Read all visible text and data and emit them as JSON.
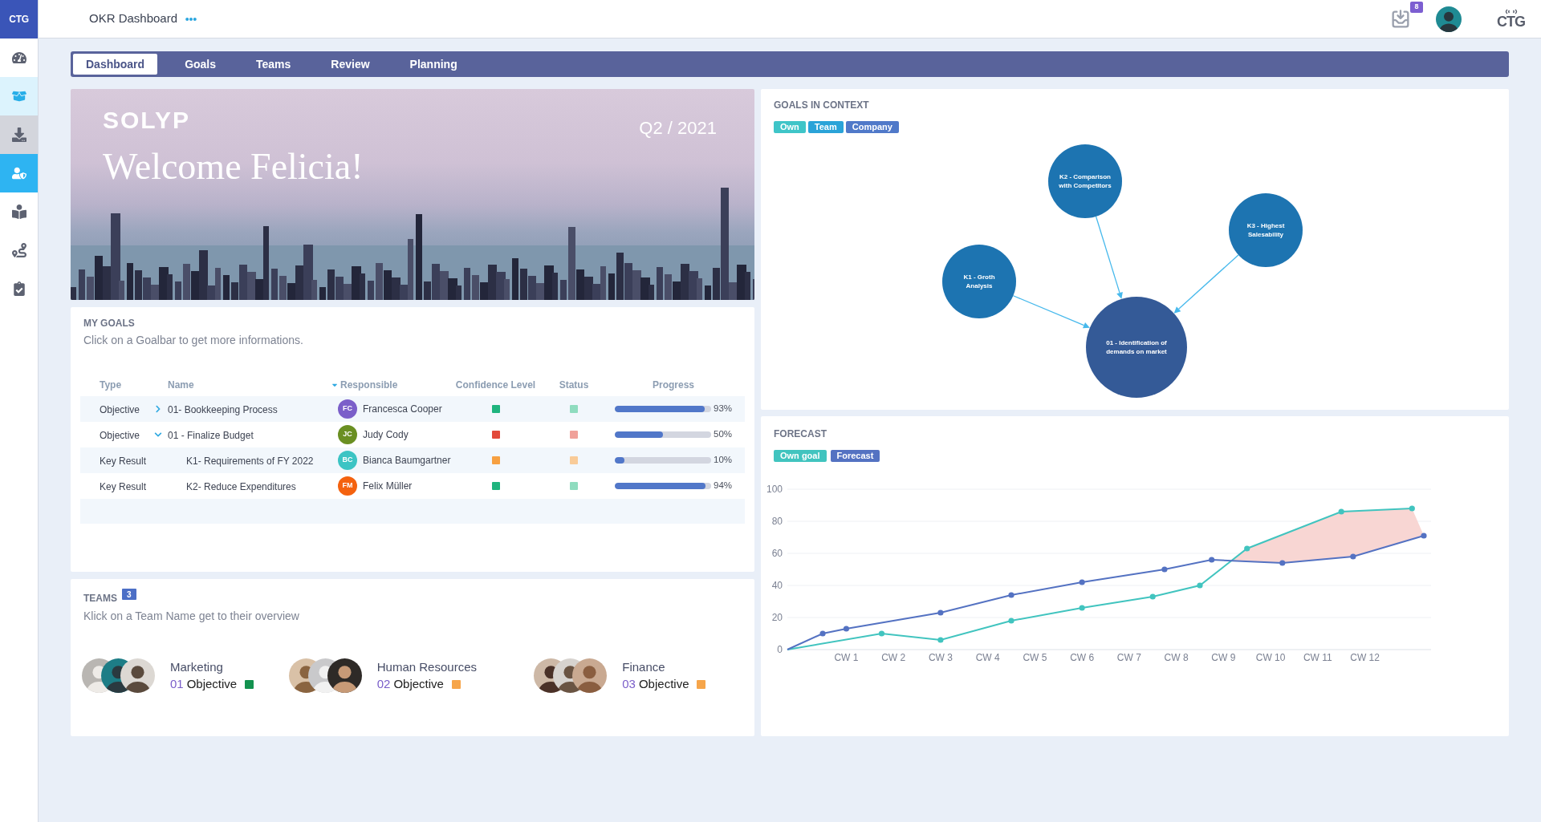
{
  "sidebar": {
    "logo": "CTG",
    "items": [
      {
        "selected": false,
        "hovered": false,
        "pressed": false
      },
      {
        "selected": false,
        "hovered": true,
        "pressed": false
      },
      {
        "selected": false,
        "hovered": false,
        "pressed": true
      },
      {
        "selected": true,
        "hovered": false,
        "pressed": false
      },
      {
        "selected": false,
        "hovered": false,
        "pressed": false
      },
      {
        "selected": false,
        "hovered": false,
        "pressed": false
      },
      {
        "selected": false,
        "hovered": false,
        "pressed": false
      }
    ]
  },
  "header": {
    "title": "OKR Dashboard",
    "notification_count": "8",
    "brand": "CTG"
  },
  "tabs": [
    {
      "label": "Dashboard",
      "selected": true
    },
    {
      "label": "Goals",
      "selected": false
    },
    {
      "label": "Teams",
      "selected": false
    },
    {
      "label": "Review",
      "selected": false
    },
    {
      "label": "Planning",
      "selected": false
    }
  ],
  "hero": {
    "brand": "SOLYP",
    "greeting": "Welcome Felicia!",
    "period": "Q2 / 2021"
  },
  "my_goals": {
    "title": "MY GOALS",
    "subtitle": "Click on a Goalbar to get more informations.",
    "columns": [
      {
        "label": "Type",
        "sorted": false
      },
      {
        "label": "Name",
        "sorted": false
      },
      {
        "label": "Responsible",
        "sorted": true
      },
      {
        "label": "Confidence Level",
        "sorted": false
      },
      {
        "label": "Status",
        "sorted": false
      },
      {
        "label": "Progress",
        "sorted": false
      }
    ],
    "rows": [
      {
        "type": "Objective",
        "name": "01- Bookkeeping Process",
        "expanded": false,
        "responsible": {
          "initials": "FC",
          "name": "Francesca Cooper",
          "color": "#7b5fc9"
        },
        "confidence": {
          "color": "#1fb47e"
        },
        "status": {
          "color": "#8fdcbf"
        },
        "level": 0.93,
        "progress": "93%"
      },
      {
        "type": "Objective",
        "name": "01 - Finalize Budget",
        "expanded": true,
        "responsible": {
          "initials": "JC",
          "name": "Judy Cody",
          "color": "#6a8f22"
        },
        "confidence": {
          "color": "#e2493a"
        },
        "status": {
          "color": "#f0a19a"
        },
        "level": 0.5,
        "progress": "50%",
        "children": [
          {
            "type": "Key Result",
            "name": "K1- Requirements of FY 2022",
            "responsible": {
              "initials": "BC",
              "name": "Bianca Baumgartner",
              "color": "#3cc4c4"
            },
            "confidence": {
              "color": "#f7a041"
            },
            "status": {
              "color": "#f9cb98"
            },
            "level": 0.1,
            "progress": "10%"
          },
          {
            "type": "Key Result",
            "name": "K2- Reduce Expenditures",
            "responsible": {
              "initials": "FM",
              "name": "Felix Müller",
              "color": "#f4620f"
            },
            "confidence": {
              "color": "#1fb47e"
            },
            "status": {
              "color": "#8fdcbf"
            },
            "level": 0.94,
            "progress": "94%"
          }
        ]
      }
    ]
  },
  "teams": {
    "title": "TEAMS",
    "count": "3",
    "subtitle": "Klick on a Team Name get to their overview",
    "items": [
      {
        "name": "Marketing",
        "number": "01",
        "label": "Objective",
        "color": "#13924f"
      },
      {
        "name": "Human Resources",
        "number": "02",
        "label": "Objective",
        "color": "#f6a54a"
      },
      {
        "name": "Finance",
        "number": "03",
        "label": "Objective",
        "color": "#f6a54a"
      }
    ]
  },
  "goals_context": {
    "title": "GOALS IN CONTEXT",
    "filters": [
      {
        "label": "Own",
        "color": "#3fc5c8"
      },
      {
        "label": "Team",
        "color": "#2aa3d8"
      },
      {
        "label": "Company",
        "color": "#5079c9"
      }
    ],
    "goal_map": {
      "label": "01 - Identification of demands on market",
      "children": [
        {
          "label": "K2 - Comparison with Competitors"
        },
        {
          "label": "K3 - Highest Salesability"
        },
        {
          "label": "K1 - Groth Analysis"
        }
      ]
    }
  },
  "forecast": {
    "title": "FORECAST",
    "chart_data": {
      "type": "line",
      "grid": true,
      "categories": [
        null,
        null,
        null,
        null,
        null,
        "CW 1",
        null,
        null,
        null,
        "CW 2",
        null,
        null,
        null,
        "CW 3",
        null,
        null,
        null,
        "CW 4",
        null,
        null,
        null,
        "CW 5",
        null,
        null,
        null,
        "CW 6",
        null,
        null,
        null,
        "CW 7",
        null,
        null,
        null,
        "CW 8",
        null,
        null,
        null,
        "CW 9",
        null,
        null,
        null,
        "CW 10",
        null,
        null,
        null,
        "CW 11",
        null,
        null,
        null,
        "CW 12",
        null,
        null,
        null,
        null,
        null
      ],
      "ylim": [
        0,
        100
      ],
      "yticks": [
        0,
        20,
        40,
        60,
        80,
        100
      ],
      "series": [
        {
          "name": "Own goal",
          "color": "#41c4bf",
          "marker": "circle",
          "values": [
            0,
            null,
            null,
            null,
            null,
            null,
            null,
            null,
            10,
            null,
            null,
            null,
            null,
            6,
            null,
            null,
            null,
            null,
            null,
            18,
            null,
            null,
            null,
            null,
            null,
            26,
            null,
            null,
            null,
            null,
            null,
            33,
            null,
            null,
            null,
            40,
            null,
            null,
            null,
            63,
            null,
            null,
            null,
            null,
            null,
            null,
            null,
            86,
            null,
            null,
            null,
            null,
            null,
            88,
            null
          ]
        },
        {
          "name": "Forecast",
          "color": "#5472c2",
          "marker": "circle",
          "values": [
            0,
            null,
            null,
            10,
            null,
            13,
            null,
            null,
            null,
            null,
            null,
            null,
            null,
            23,
            null,
            null,
            null,
            null,
            null,
            34,
            null,
            null,
            null,
            null,
            null,
            42,
            null,
            null,
            null,
            null,
            null,
            null,
            50,
            null,
            null,
            null,
            56,
            null,
            null,
            null,
            null,
            null,
            54,
            null,
            null,
            null,
            null,
            null,
            58,
            null,
            null,
            null,
            null,
            null,
            71
          ]
        }
      ]
    }
  }
}
